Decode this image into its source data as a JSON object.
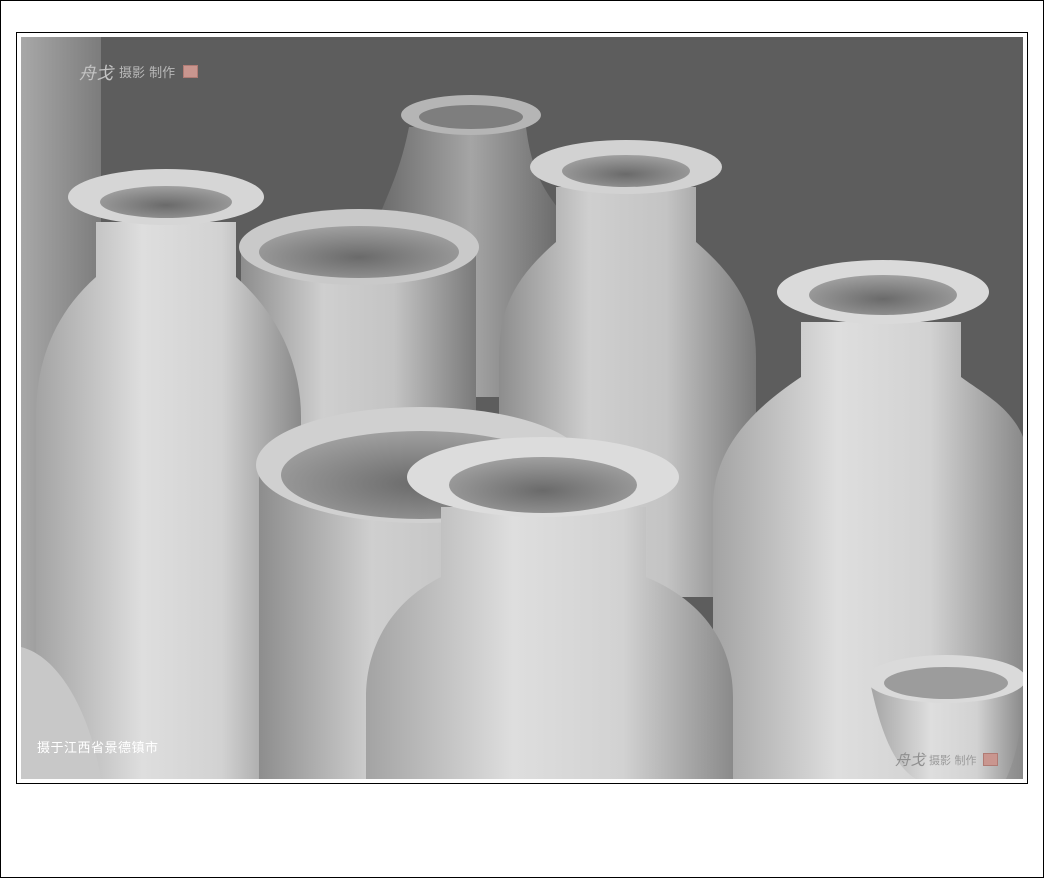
{
  "photo": {
    "caption": "摄于江西省景德镇市",
    "watermark_top": {
      "script": "舟戈",
      "text": "摄影 制作"
    },
    "watermark_bottom": {
      "script": "舟戈",
      "text": "摄影 制作"
    },
    "colors": {
      "background": "#5d5d5d",
      "porcelain": "#d4d4d4"
    }
  }
}
